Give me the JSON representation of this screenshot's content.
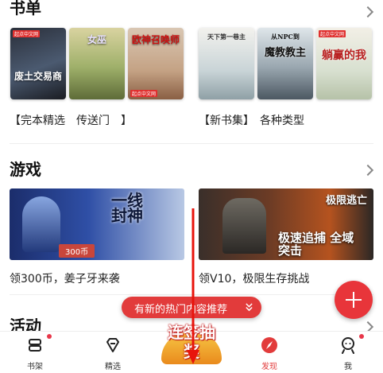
{
  "booklists": {
    "title": "书单",
    "groups": [
      {
        "label": "【完本精选　传送门　】",
        "books": [
          {
            "cover_title": "废土交易商",
            "tag": "起点中文网"
          },
          {
            "cover_title": "女巫",
            "tag": ""
          },
          {
            "cover_title": "欧神召唤师",
            "tag": "起点中文网"
          }
        ]
      },
      {
        "label": "【新书集】　各种类型",
        "books": [
          {
            "cover_title": "天下第一巷主",
            "tag": ""
          },
          {
            "cover_title": "魔教教主",
            "subtitle": "从NPC到",
            "tag": ""
          },
          {
            "cover_title": "躺赢的我",
            "tag": "起点中文网"
          }
        ]
      }
    ]
  },
  "games": {
    "title": "游戏",
    "items": [
      {
        "banner_text": "一线封神",
        "price": "300币",
        "caption": "领300币，姜子牙来袭"
      },
      {
        "banner_text": "极速追捕 全域突击",
        "logo": "极限逃亡",
        "caption": "领V10，极限生存挑战"
      }
    ]
  },
  "activities": {
    "title": "活动"
  },
  "toast": {
    "text": "有新的热门内容推荐"
  },
  "center_badge": {
    "text": "连签抽奖"
  },
  "nav": {
    "items": [
      {
        "label": "书架",
        "icon": "bookshelf-icon",
        "badge": true
      },
      {
        "label": "精选",
        "icon": "diamond-icon",
        "badge": false
      },
      {
        "label": "发现",
        "icon": "compass-icon",
        "badge": false,
        "active": true
      },
      {
        "label": "我",
        "icon": "profile-icon",
        "badge": true
      }
    ]
  },
  "colors": {
    "accent": "#e8353a",
    "active": "#e23b3b"
  }
}
